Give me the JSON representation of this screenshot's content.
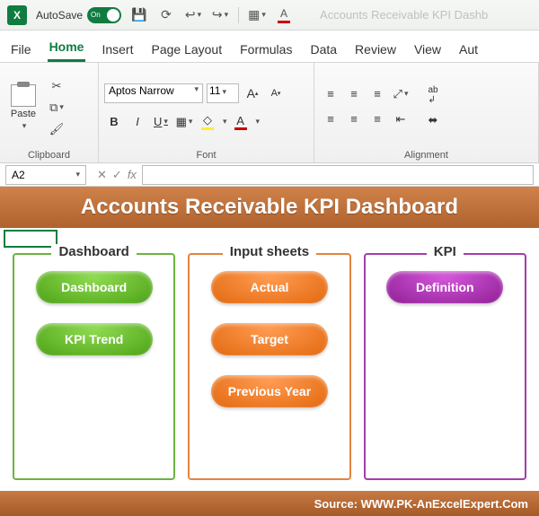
{
  "titlebar": {
    "autosave_label": "AutoSave",
    "autosave_state": "On",
    "doc_title": "Accounts Receivable KPI Dashb"
  },
  "tabs": [
    "File",
    "Home",
    "Insert",
    "Page Layout",
    "Formulas",
    "Data",
    "Review",
    "View",
    "Aut"
  ],
  "active_tab": 1,
  "ribbon": {
    "clipboard": {
      "label": "Clipboard",
      "paste": "Paste"
    },
    "font": {
      "label": "Font",
      "name": "Aptos Narrow",
      "size": "11",
      "bold": "B",
      "italic": "I",
      "underline": "U",
      "grow": "A",
      "shrink": "A"
    },
    "alignment": {
      "label": "Alignment"
    }
  },
  "namebox": "A2",
  "fx_label": "fx",
  "sheet": {
    "banner": "Accounts Receivable KPI Dashboard",
    "cards": [
      {
        "title": "Dashboard",
        "color": "green",
        "buttons": [
          "Dashboard",
          "KPI Trend"
        ]
      },
      {
        "title": "Input sheets",
        "color": "orange",
        "buttons": [
          "Actual",
          "Target",
          "Previous Year"
        ]
      },
      {
        "title": "KPI",
        "color": "purple",
        "buttons": [
          "Definition"
        ]
      }
    ],
    "footer": "Source: WWW.PK-AnExcelExpert.Com"
  }
}
